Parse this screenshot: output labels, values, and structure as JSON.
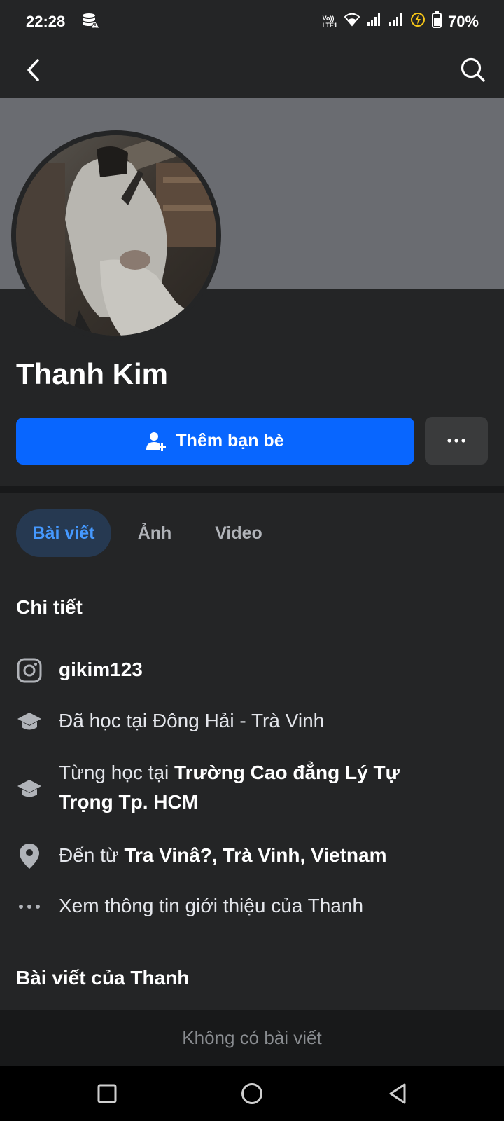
{
  "status_bar": {
    "time": "22:28",
    "battery_percent": "70%",
    "network_label_top": "Vo))",
    "network_label_bottom": "LTE1",
    "battery_level": 0.7
  },
  "app_bar": {
    "back_icon": "chevron-left-icon",
    "search_icon": "search-icon"
  },
  "profile": {
    "name": "Thanh Kim",
    "add_friend_label": "Thêm bạn bè",
    "more_label": "···"
  },
  "tabs": [
    {
      "label": "Bài viết",
      "active": true
    },
    {
      "label": "Ảnh",
      "active": false
    },
    {
      "label": "Video",
      "active": false
    }
  ],
  "details": {
    "title": "Chi tiết",
    "instagram": "gikim123",
    "studied_at_prefix": "Đã học tại Đông Hải - Trà Vinh",
    "former_school_prefix": "Từng học tại ",
    "former_school_name": "Trường Cao đẳng Lý Tự Trọng Tp. HCM",
    "from_prefix": "Đến từ ",
    "from_place": "Tra Vinâ?, Trà Vinh, Vietnam",
    "see_about": "Xem thông tin giới thiệu của Thanh"
  },
  "posts": {
    "title": "Bài viết của Thanh",
    "empty_text": "Không có bài viết"
  },
  "colors": {
    "background": "#242526",
    "primary_blue": "#0866ff",
    "active_tab_bg": "#263951",
    "active_tab_text": "#4599ff"
  }
}
